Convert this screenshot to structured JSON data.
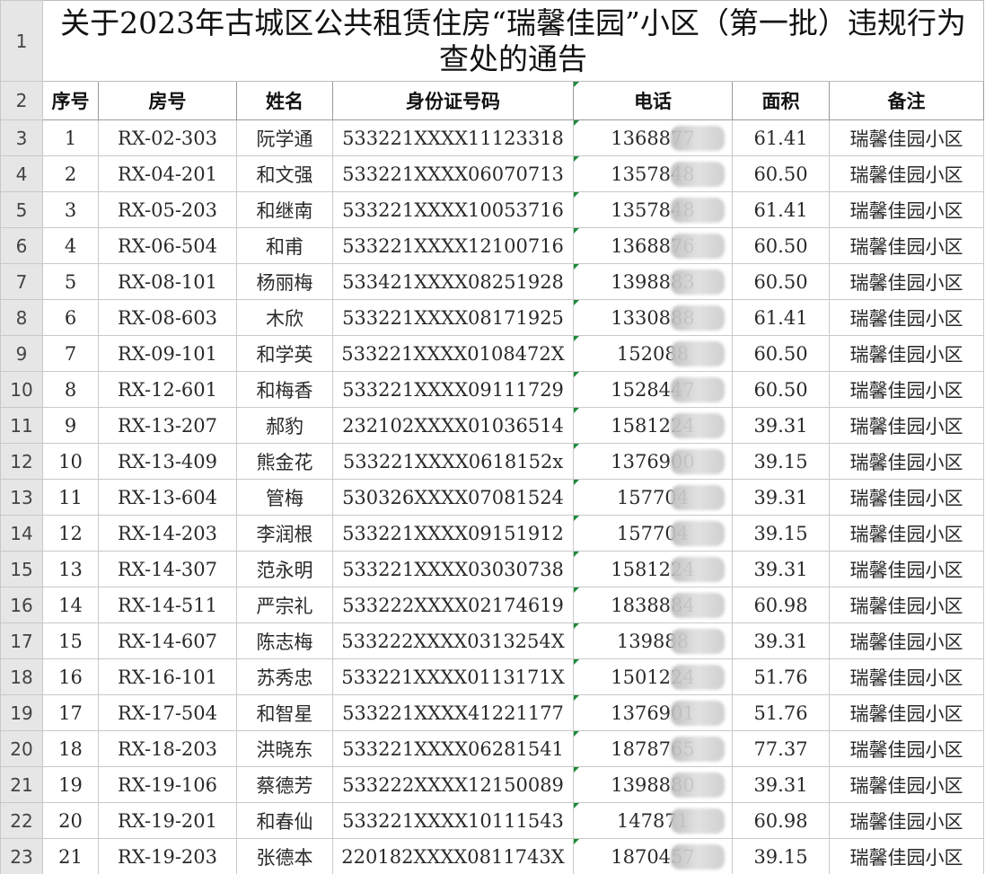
{
  "title": "关于2023年古城区公共租赁住房“瑞馨佳园”小区（第一批）违规行为查处的通告",
  "row_numbers": [
    "1",
    "2",
    "3",
    "4",
    "5",
    "6",
    "7",
    "8",
    "9",
    "10",
    "11",
    "12",
    "13",
    "14",
    "15",
    "16",
    "17",
    "18",
    "19",
    "20",
    "21",
    "22",
    "23"
  ],
  "headers": [
    "序号",
    "房号",
    "姓名",
    "身份证号码",
    "电话",
    "面积",
    "备注"
  ],
  "rows": [
    {
      "seq": "1",
      "room": "RX-02-303",
      "name": "阮学通",
      "id": "533221XXXX11123318",
      "phone": "1368877",
      "area": "61.41",
      "note": "瑞馨佳园小区"
    },
    {
      "seq": "2",
      "room": "RX-04-201",
      "name": "和文强",
      "id": "533221XXXX06070713",
      "phone": "1357848",
      "area": "60.50",
      "note": "瑞馨佳园小区"
    },
    {
      "seq": "3",
      "room": "RX-05-203",
      "name": "和继南",
      "id": "533221XXXX10053716",
      "phone": "1357848",
      "area": "61.41",
      "note": "瑞馨佳园小区"
    },
    {
      "seq": "4",
      "room": "RX-06-504",
      "name": "和甫",
      "id": "533221XXXX12100716",
      "phone": "1368876",
      "area": "60.50",
      "note": "瑞馨佳园小区"
    },
    {
      "seq": "5",
      "room": "RX-08-101",
      "name": "杨丽梅",
      "id": "533421XXXX08251928",
      "phone": "1398883",
      "area": "60.50",
      "note": "瑞馨佳园小区"
    },
    {
      "seq": "6",
      "room": "RX-08-603",
      "name": "木欣",
      "id": "533221XXXX08171925",
      "phone": "1330888",
      "area": "61.41",
      "note": "瑞馨佳园小区"
    },
    {
      "seq": "7",
      "room": "RX-09-101",
      "name": "和学英",
      "id": "533221XXXX0108472X",
      "phone": "152088",
      "area": "60.50",
      "note": "瑞馨佳园小区"
    },
    {
      "seq": "8",
      "room": "RX-12-601",
      "name": "和梅香",
      "id": "533221XXXX09111729",
      "phone": "1528447",
      "area": "60.50",
      "note": "瑞馨佳园小区"
    },
    {
      "seq": "9",
      "room": "RX-13-207",
      "name": "郝豹",
      "id": "232102XXXX01036514",
      "phone": "1581224",
      "area": "39.31",
      "note": "瑞馨佳园小区"
    },
    {
      "seq": "10",
      "room": "RX-13-409",
      "name": "熊金花",
      "id": "533221XXXX0618152x",
      "phone": "1376900",
      "area": "39.15",
      "note": "瑞馨佳园小区"
    },
    {
      "seq": "11",
      "room": "RX-13-604",
      "name": "管梅",
      "id": "530326XXXX07081524",
      "phone": "157704",
      "area": "39.31",
      "note": "瑞馨佳园小区"
    },
    {
      "seq": "12",
      "room": "RX-14-203",
      "name": "李润根",
      "id": "533221XXXX09151912",
      "phone": "157704",
      "area": "39.15",
      "note": "瑞馨佳园小区"
    },
    {
      "seq": "13",
      "room": "RX-14-307",
      "name": "范永明",
      "id": "533221XXXX03030738",
      "phone": "1581224",
      "area": "39.31",
      "note": "瑞馨佳园小区"
    },
    {
      "seq": "14",
      "room": "RX-14-511",
      "name": "严宗礼",
      "id": "533222XXXX02174619",
      "phone": "1838884",
      "area": "60.98",
      "note": "瑞馨佳园小区"
    },
    {
      "seq": "15",
      "room": "RX-14-607",
      "name": "陈志梅",
      "id": "533222XXXX0313254X",
      "phone": "139888",
      "area": "39.31",
      "note": "瑞馨佳园小区"
    },
    {
      "seq": "16",
      "room": "RX-16-101",
      "name": "苏秀忠",
      "id": "533221XXXX0113171X",
      "phone": "1501224",
      "area": "51.76",
      "note": "瑞馨佳园小区"
    },
    {
      "seq": "17",
      "room": "RX-17-504",
      "name": "和智星",
      "id": "533221XXXX41221177",
      "phone": "1376901",
      "area": "51.76",
      "note": "瑞馨佳园小区"
    },
    {
      "seq": "18",
      "room": "RX-18-203",
      "name": "洪晓东",
      "id": "533221XXXX06281541",
      "phone": "1878765",
      "area": "77.37",
      "note": "瑞馨佳园小区"
    },
    {
      "seq": "19",
      "room": "RX-19-106",
      "name": "蔡德芳",
      "id": "533222XXXX12150089",
      "phone": "1398880",
      "area": "39.31",
      "note": "瑞馨佳园小区"
    },
    {
      "seq": "20",
      "room": "RX-19-201",
      "name": "和春仙",
      "id": "533221XXXX10111543",
      "phone": "147871",
      "area": "60.98",
      "note": "瑞馨佳园小区"
    },
    {
      "seq": "21",
      "room": "RX-19-203",
      "name": "张德本",
      "id": "220182XXXX0811743X",
      "phone": "1870457",
      "area": "39.15",
      "note": "瑞馨佳园小区"
    }
  ],
  "colors": {
    "row_header_bg": "#e6e6e6",
    "grid_line": "#d4d4d4",
    "comment_marker": "#1e8a3a"
  }
}
